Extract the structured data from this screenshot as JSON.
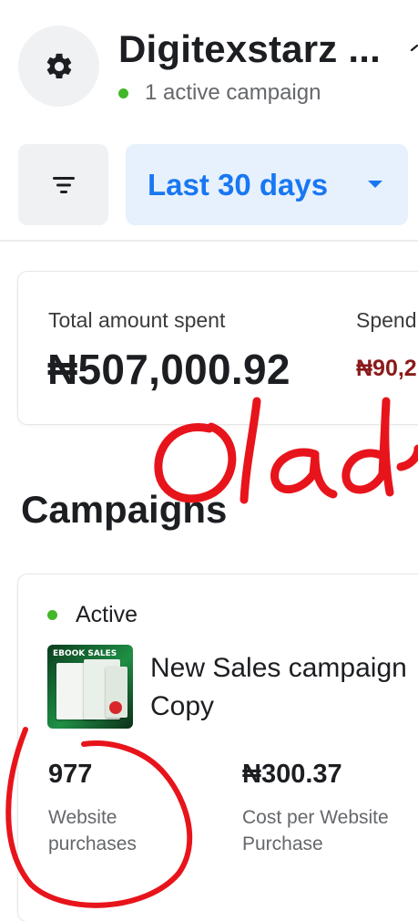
{
  "header": {
    "account_name": "Digitexstarz ...",
    "status": "1 active campaign"
  },
  "filters": {
    "date_range": "Last 30 days"
  },
  "summary": {
    "total_label": "Total amount spent",
    "total_value": "₦507,000.92",
    "spend_label": "Spend",
    "spend_value": "₦90,2"
  },
  "campaigns": {
    "section_title": "Campaigns",
    "items": [
      {
        "status": "Active",
        "thumbnail_text": "EBOOK SALES",
        "name": "New Sales campaign Copy",
        "metric_1_value": "977",
        "metric_1_label": "Website purchases",
        "metric_2_value": "₦300.37",
        "metric_2_label": "Cost per Website Purchase"
      }
    ]
  },
  "annotation": {
    "handwriting": "Olade"
  },
  "colors": {
    "accent": "#1877f2",
    "active": "#42b72a",
    "annotation": "#e8141b"
  }
}
